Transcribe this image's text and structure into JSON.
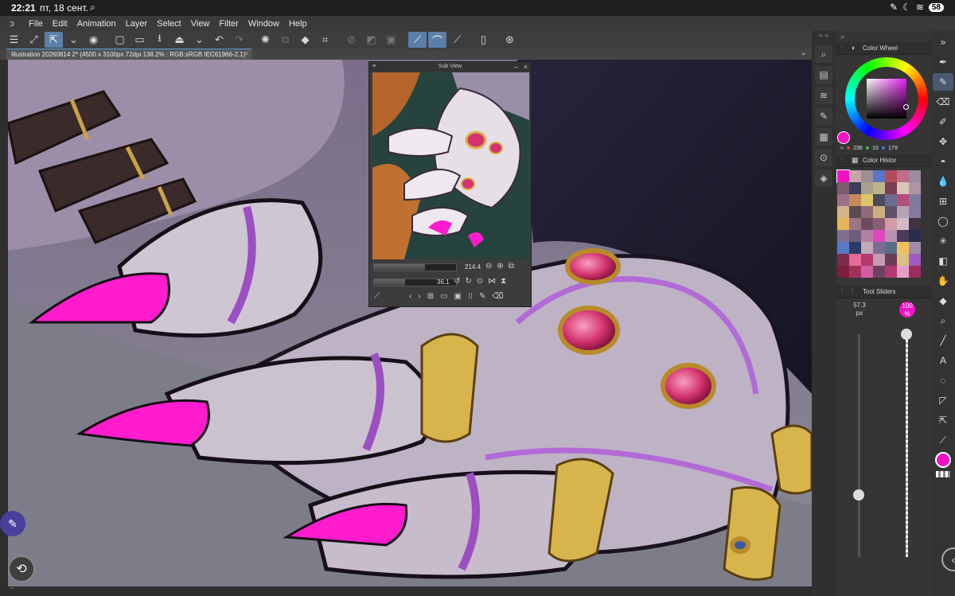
{
  "status_bar": {
    "time": "22:21",
    "date": "пт, 18 сент.",
    "battery": "58"
  },
  "menu": {
    "items": [
      "File",
      "Edit",
      "Animation",
      "Layer",
      "Select",
      "View",
      "Filter",
      "Window",
      "Help"
    ]
  },
  "tab": {
    "title": "Illustration 20260814 2* (4500 x 3100px 72dpi 138.2% : RGB:sRGB IEC61966-2.1)",
    "close": "×"
  },
  "subview": {
    "title": "Sub View",
    "zoom": "214.4",
    "rotation": "36.1",
    "zoom_fraction": 0.62,
    "rotation_fraction": 0.38
  },
  "panels": {
    "color_wheel": {
      "title": "Color Wheel",
      "r": "236",
      "g": "10",
      "b": "179",
      "current_color": "#f312c3"
    },
    "color_history": {
      "title": "Color Histor",
      "swatches": [
        "#f312c3",
        "#c8a6a7",
        "#9e8c96",
        "#5a76c4",
        "#b34d5b",
        "#c06e86",
        "#9b8aa0",
        "#7c5d6b",
        "#3c3e5a",
        "#a9a08c",
        "#bfb489",
        "#7a3e55",
        "#d8c7b5",
        "#ad94a6",
        "#9e6f88",
        "#c58a58",
        "#dcc46c",
        "#4a4a59",
        "#6b6c8e",
        "#b54e7b",
        "#7e7aa0",
        "#d6b28a",
        "#5b4a4f",
        "#8d6b79",
        "#c9b07e",
        "#5d5168",
        "#b7a3b8",
        "#86799e",
        "#e6b35a",
        "#9d7587",
        "#6c4b5c",
        "#8a5e70",
        "#d09ba7",
        "#d3b8c6",
        "#3f3443",
        "#7e6f8d",
        "#6e5d7a",
        "#b57fa0",
        "#df47c0",
        "#b894b3",
        "#4b3c57",
        "#2a2d4b",
        "#5a79c8",
        "#2b3a66",
        "#c1a9b6",
        "#7a6e8f",
        "#5a6d88",
        "#f0c060",
        "#a28ca8",
        "#7a2c4a",
        "#e66a9a",
        "#b03a6d",
        "#c49ab5",
        "#6b3b55",
        "#d8c080",
        "#a05ac4",
        "#7c1f3e",
        "#a13257",
        "#d15ca1",
        "#6e4260",
        "#b33a70",
        "#e0a0c8",
        "#9a2e60"
      ]
    },
    "tool_sliders": {
      "title": "Tool Sliders",
      "size_value": "57.3",
      "size_unit": "px",
      "opacity_value": "100",
      "opacity_unit": "%",
      "size_fraction": 0.28,
      "opacity_fraction": 1.0
    }
  },
  "icons": {
    "menu_logo": "clip-studio-logo-icon"
  }
}
